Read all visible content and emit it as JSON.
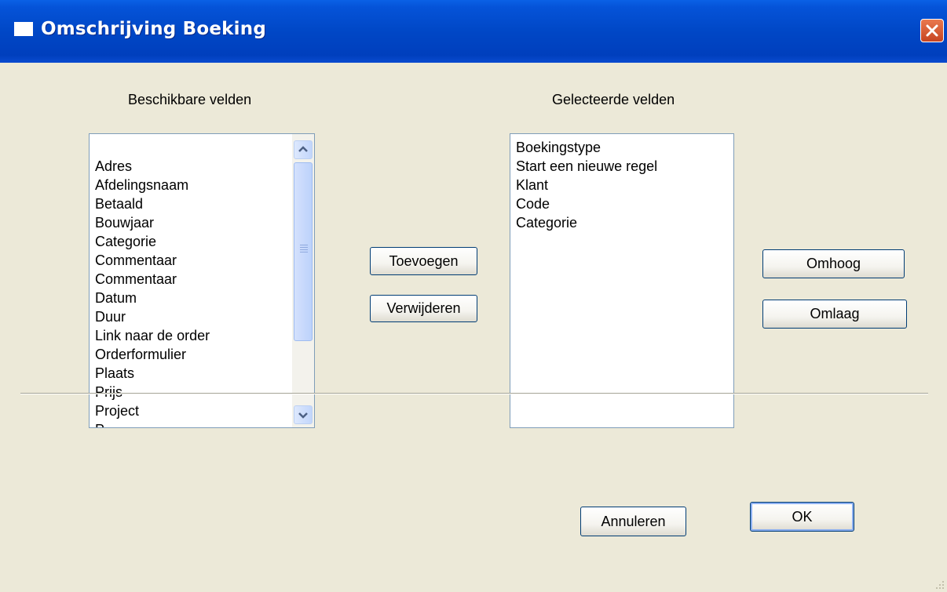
{
  "window": {
    "title": "Omschrijving Boeking",
    "title_icon": "window-icon",
    "close_icon": "close-icon"
  },
  "available": {
    "label": "Beschikbare velden",
    "items": [
      "Adres",
      "Afdelingsnaam",
      "Betaald",
      "Bouwjaar",
      "Categorie",
      "Commentaar",
      "Commentaar",
      "Datum",
      "Duur",
      "Link naar de order",
      "Orderformulier",
      "Plaats",
      "Prijs",
      "Project",
      "P"
    ]
  },
  "selected": {
    "label": "Gelecteerde velden",
    "items": [
      "Boekingstype",
      "Start een nieuwe regel",
      "Klant",
      "Code",
      "Categorie"
    ]
  },
  "buttons": {
    "add": "Toevoegen",
    "remove": "Verwijderen",
    "up": "Omhoog",
    "down": "Omlaag",
    "cancel": "Annuleren",
    "ok": "OK"
  },
  "icons": {
    "scroll_up": "scroll-up-icon",
    "scroll_down": "scroll-down-icon",
    "resize": "resize-grip-icon"
  },
  "colors": {
    "titlebar": "#0047c6",
    "dialog_bg": "#ece9d8",
    "button_border": "#003c74",
    "listbox_border": "#7f9db9",
    "close_button": "#c64421"
  }
}
